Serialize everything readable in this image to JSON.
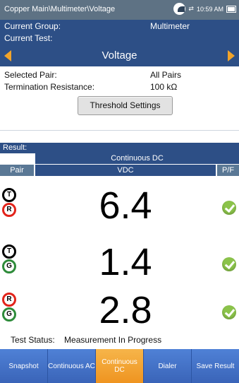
{
  "titlebar": {
    "path": "Copper Main\\Multimeter\\Voltage",
    "time": "10:59 AM"
  },
  "group": {
    "label": "Current Group:",
    "value": "Multimeter"
  },
  "test": {
    "label": "Current Test:",
    "value": "Voltage"
  },
  "params": [
    {
      "label": "Selected Pair:",
      "value": "All Pairs"
    },
    {
      "label": "Termination Resistance:",
      "value": "100 kΩ"
    }
  ],
  "threshold_button": "Threshold Settings",
  "result": {
    "header": "Result:",
    "mode": "Continuous DC",
    "cols": {
      "pair": "Pair",
      "vdc": "VDC",
      "pf": "P/F"
    }
  },
  "rows": [
    {
      "wire1": "T",
      "wire2": "R",
      "value": "6.4",
      "status": "pass"
    },
    {
      "wire1": "T",
      "wire2": "G",
      "value": "1.4",
      "status": "pass"
    },
    {
      "wire1": "R",
      "wire2": "G",
      "value": "2.8",
      "status": "pass"
    }
  ],
  "test_status": {
    "label": "Test Status:",
    "value": "Measurement In Progress"
  },
  "bottom_buttons": [
    {
      "label": "Snapshot",
      "active": false
    },
    {
      "label": "Continuous AC",
      "active": false
    },
    {
      "label": "Continuous DC",
      "active": true
    },
    {
      "label": "Dialer",
      "active": false
    },
    {
      "label": "Save Result",
      "active": false
    }
  ],
  "colors": {
    "header_blue": "#2d4f86",
    "accent_orange": "#f2a42a",
    "pass_green": "#8bc34a",
    "button_blue": "#3e6ec8"
  }
}
